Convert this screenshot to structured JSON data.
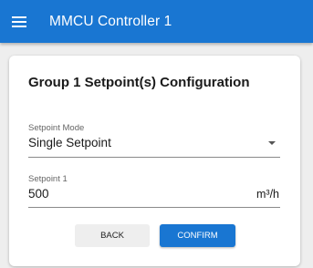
{
  "appbar": {
    "title": "MMCU Controller 1",
    "menu_icon": "hamburger-menu-icon",
    "color": "#1976d2"
  },
  "card": {
    "title": "Group 1 Setpoint(s) Configuration",
    "setpoint_mode": {
      "label": "Setpoint Mode",
      "value": "Single Setpoint",
      "icon": "dropdown-arrow-icon"
    },
    "setpoint_1": {
      "label": "Setpoint 1",
      "value": "500",
      "unit": "m³/h"
    },
    "buttons": {
      "back_label": "BACK",
      "confirm_label": "CONFIRM"
    }
  }
}
